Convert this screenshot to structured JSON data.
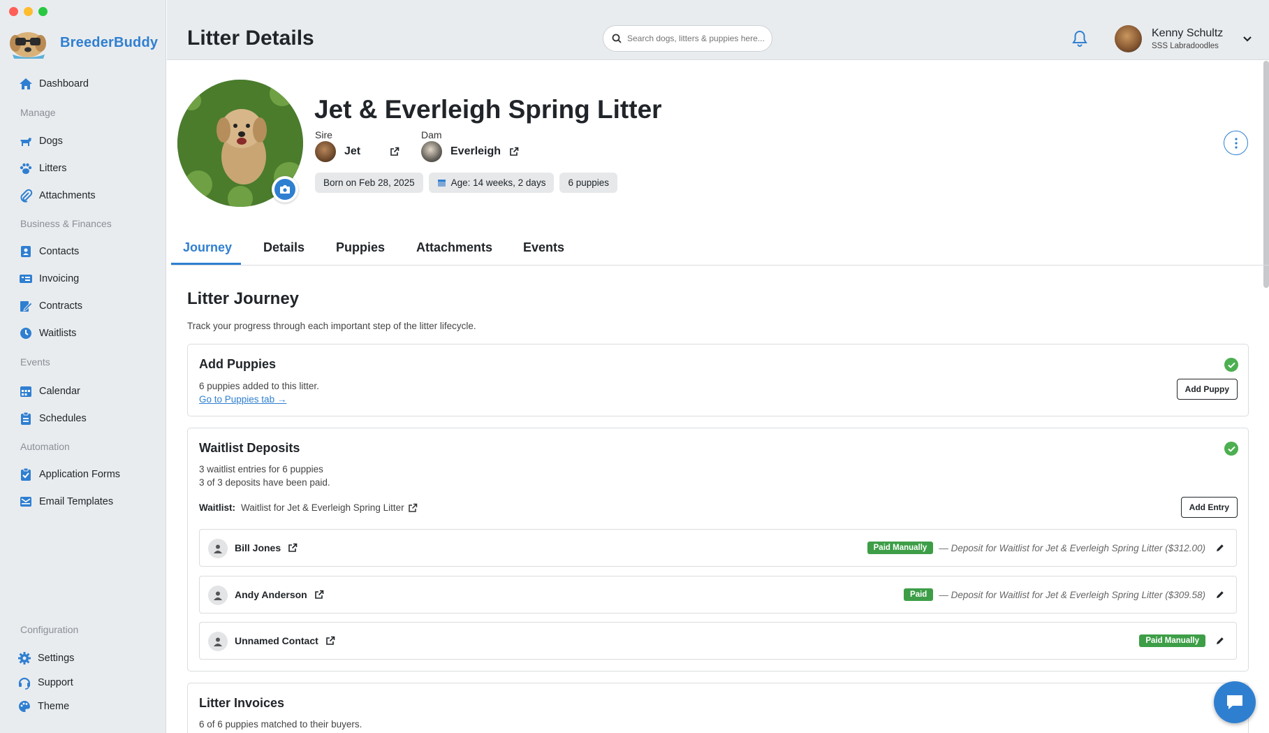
{
  "app": {
    "name": "BreederBuddy"
  },
  "window": {
    "traffic_colors": [
      "#ff5f57",
      "#febc2e",
      "#28c840"
    ]
  },
  "sidebar": {
    "dashboard": "Dashboard",
    "sections": {
      "manage": "Manage",
      "business": "Business & Finances",
      "events": "Events",
      "automation": "Automation",
      "configuration": "Configuration"
    },
    "items": {
      "dogs": "Dogs",
      "litters": "Litters",
      "attachments": "Attachments",
      "contacts": "Contacts",
      "invoicing": "Invoicing",
      "contracts": "Contracts",
      "waitlists": "Waitlists",
      "calendar": "Calendar",
      "schedules": "Schedules",
      "application_forms": "Application Forms",
      "email_templates": "Email Templates",
      "settings": "Settings",
      "support": "Support",
      "theme": "Theme"
    }
  },
  "header": {
    "title": "Litter Details",
    "search_placeholder": "Search dogs, litters & puppies here...",
    "user": {
      "name": "Kenny Schultz",
      "org": "SSS Labradoodles"
    }
  },
  "litter": {
    "title": "Jet & Everleigh Spring Litter",
    "sire_label": "Sire",
    "sire_name": "Jet",
    "dam_label": "Dam",
    "dam_name": "Everleigh",
    "born": "Born on Feb 28, 2025",
    "age": "Age: 14 weeks, 2 days",
    "puppies_count": "6 puppies"
  },
  "tabs": {
    "journey": "Journey",
    "details": "Details",
    "puppies": "Puppies",
    "attachments": "Attachments",
    "events": "Events",
    "active": "Journey"
  },
  "journey": {
    "title": "Litter Journey",
    "subtitle": "Track your progress through each important step of the litter lifecycle.",
    "add_puppies": {
      "title": "Add Puppies",
      "text": "6 puppies added to this litter.",
      "link": "Go to Puppies tab →",
      "button": "Add Puppy",
      "complete": true
    },
    "waitlist_deposits": {
      "title": "Waitlist Deposits",
      "line1": "3 waitlist entries for 6 puppies",
      "line2": "3 of 3 deposits have been paid.",
      "waitlist_label": "Waitlist:",
      "waitlist_name": "Waitlist for Jet & Everleigh Spring Litter",
      "button": "Add Entry",
      "complete": true,
      "entries": [
        {
          "name": "Bill Jones",
          "status": "Paid Manually",
          "deposit": "— Deposit for Waitlist for Jet & Everleigh Spring Litter ($312.00)"
        },
        {
          "name": "Andy Anderson",
          "status": "Paid",
          "deposit": "— Deposit for Waitlist for Jet & Everleigh Spring Litter ($309.58)"
        },
        {
          "name": "Unnamed Contact",
          "status": "Paid Manually",
          "deposit": ""
        }
      ]
    },
    "litter_invoices": {
      "title": "Litter Invoices",
      "text": "6 of 6 puppies matched to their buyers."
    }
  },
  "colors": {
    "accent": "#2f7fd1",
    "success": "#3d9e47",
    "sidebar_bg": "#e9ecef"
  }
}
